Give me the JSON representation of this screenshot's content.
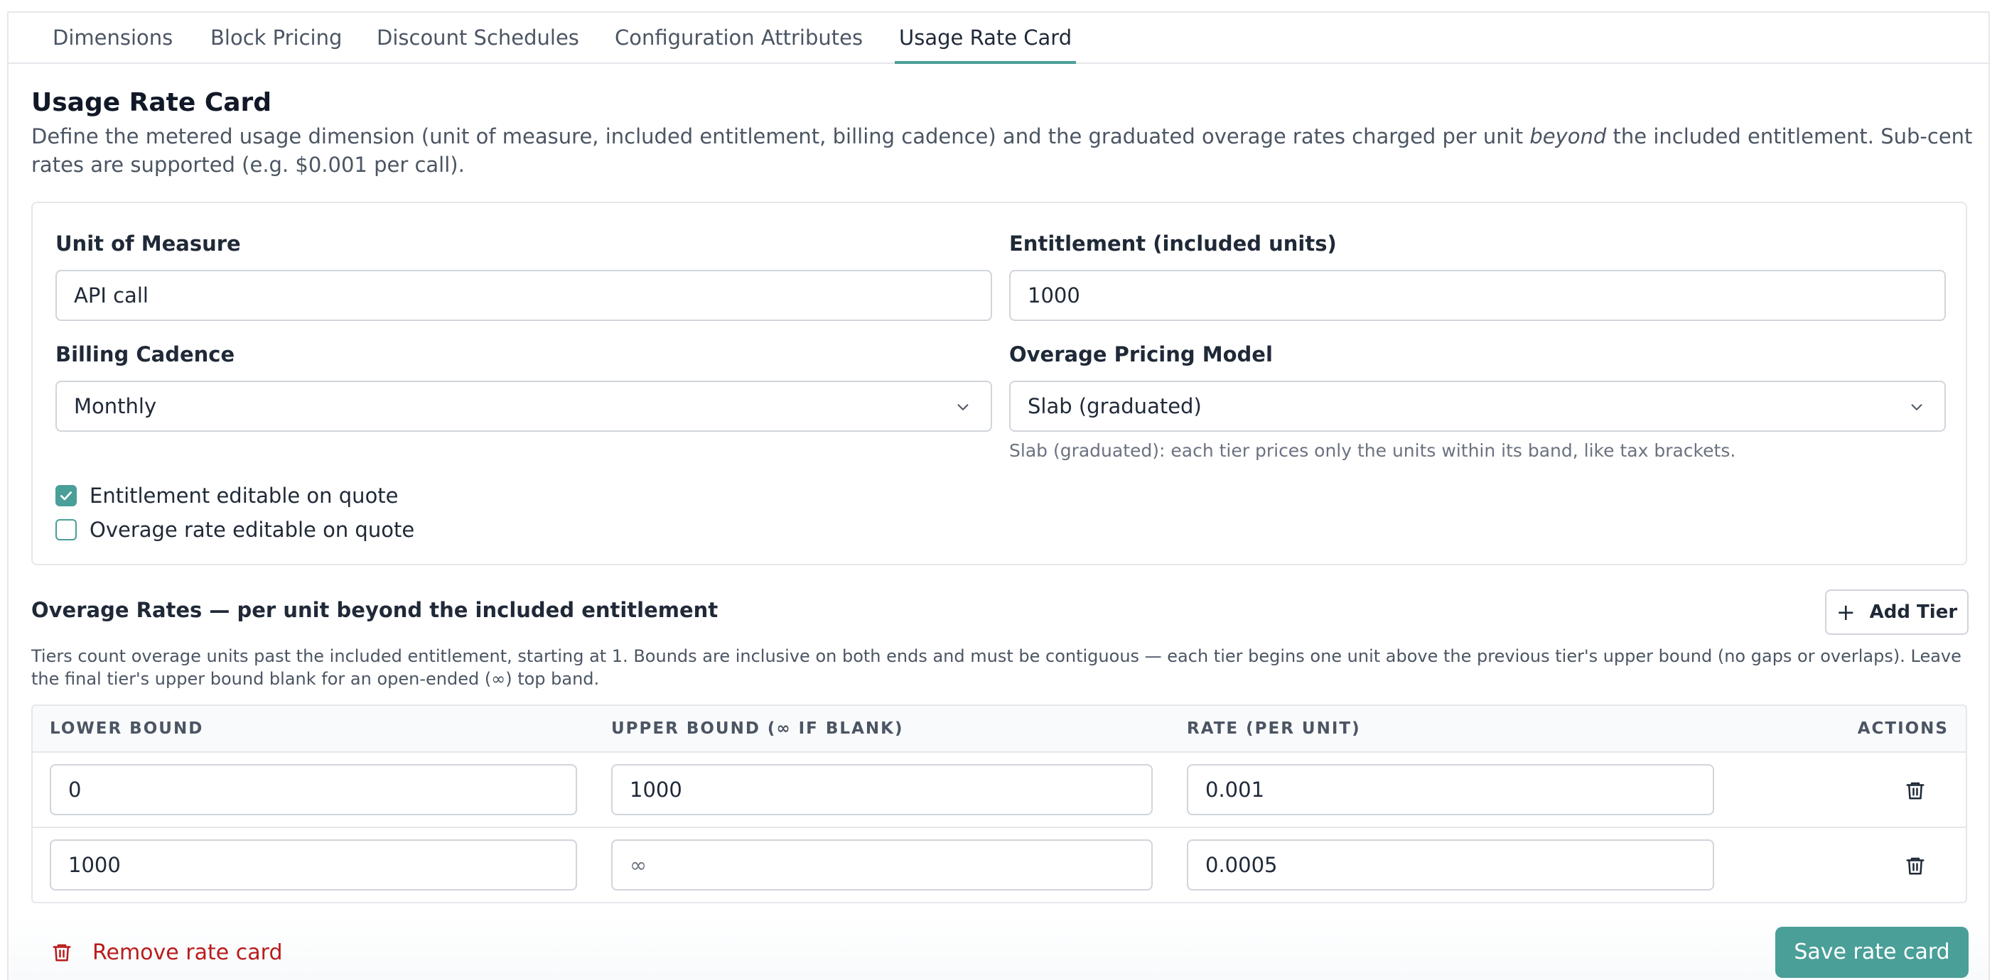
{
  "tabs": [
    {
      "label": "Dimensions"
    },
    {
      "label": "Block Pricing"
    },
    {
      "label": "Discount Schedules"
    },
    {
      "label": "Configuration Attributes"
    },
    {
      "label": "Usage Rate Card"
    }
  ],
  "active_tab": "Usage Rate Card",
  "header": {
    "title": "Usage Rate Card",
    "desc_before": "Define the metered usage dimension (unit of measure, included entitlement, billing cadence) and the graduated overage rates charged per unit ",
    "desc_emph": "beyond",
    "desc_after": " the included entitlement. Sub-cent rates are supported (e.g. $0.001 per call)."
  },
  "form": {
    "unit_of_measure": {
      "label": "Unit of Measure",
      "value": "API call"
    },
    "entitlement": {
      "label": "Entitlement (included units)",
      "value": "1000"
    },
    "billing_cadence": {
      "label": "Billing Cadence",
      "value": "Monthly"
    },
    "overage_model": {
      "label": "Overage Pricing Model",
      "value": "Slab (graduated)",
      "hint": "Slab (graduated): each tier prices only the units within its band, like tax brackets."
    },
    "checkboxes": [
      {
        "label": "Entitlement editable on quote",
        "checked": true
      },
      {
        "label": "Overage rate editable on quote",
        "checked": false
      }
    ]
  },
  "overage": {
    "title": "Overage Rates — per unit beyond the included entitlement",
    "add_tier_label": "Add Tier",
    "description": "Tiers count overage units past the included entitlement, starting at 1. Bounds are inclusive on both ends and must be contiguous — each tier begins one unit above the previous tier's upper bound (no gaps or overlaps). Leave the final tier's upper bound blank for an open-ended (∞) top band.",
    "columns": [
      "LOWER BOUND",
      "UPPER BOUND (∞ IF BLANK)",
      "RATE (PER UNIT)",
      "ACTIONS"
    ],
    "rows": [
      {
        "lower": "0",
        "upper": "1000",
        "upper_placeholder": "",
        "rate": "0.001"
      },
      {
        "lower": "1000",
        "upper": "",
        "upper_placeholder": "∞",
        "rate": "0.0005"
      }
    ]
  },
  "footer": {
    "remove_label": "Remove rate card",
    "save_label": "Save rate card"
  },
  "colors": {
    "accent": "#4a9f98",
    "danger": "#b91c1c",
    "border": "#d1d5db"
  }
}
